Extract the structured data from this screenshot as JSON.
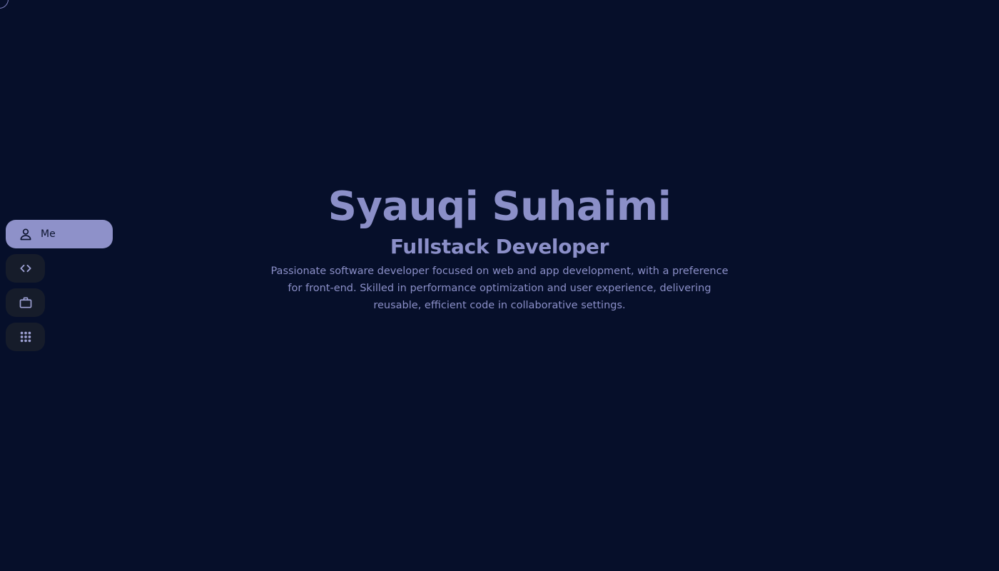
{
  "nav": {
    "items": [
      {
        "label": "Me",
        "icon": "person-icon",
        "active": true
      },
      {
        "label": "",
        "icon": "code-icon",
        "active": false
      },
      {
        "label": "",
        "icon": "briefcase-icon",
        "active": false
      },
      {
        "label": "",
        "icon": "apps-grid-icon",
        "active": false
      }
    ]
  },
  "hero": {
    "name": "Syauqi Suhaimi",
    "title": "Fullstack Developer",
    "description": "Passionate software developer focused on web and app development, with a preference for front-end. Skilled in performance optimization and user experience, delivering reusable, efficient code in collaborative settings."
  },
  "colors": {
    "background": "#060f2a",
    "accent": "#8e91c9",
    "nav_inactive_bg": "#161c2a",
    "text": "#8b8fc8"
  }
}
